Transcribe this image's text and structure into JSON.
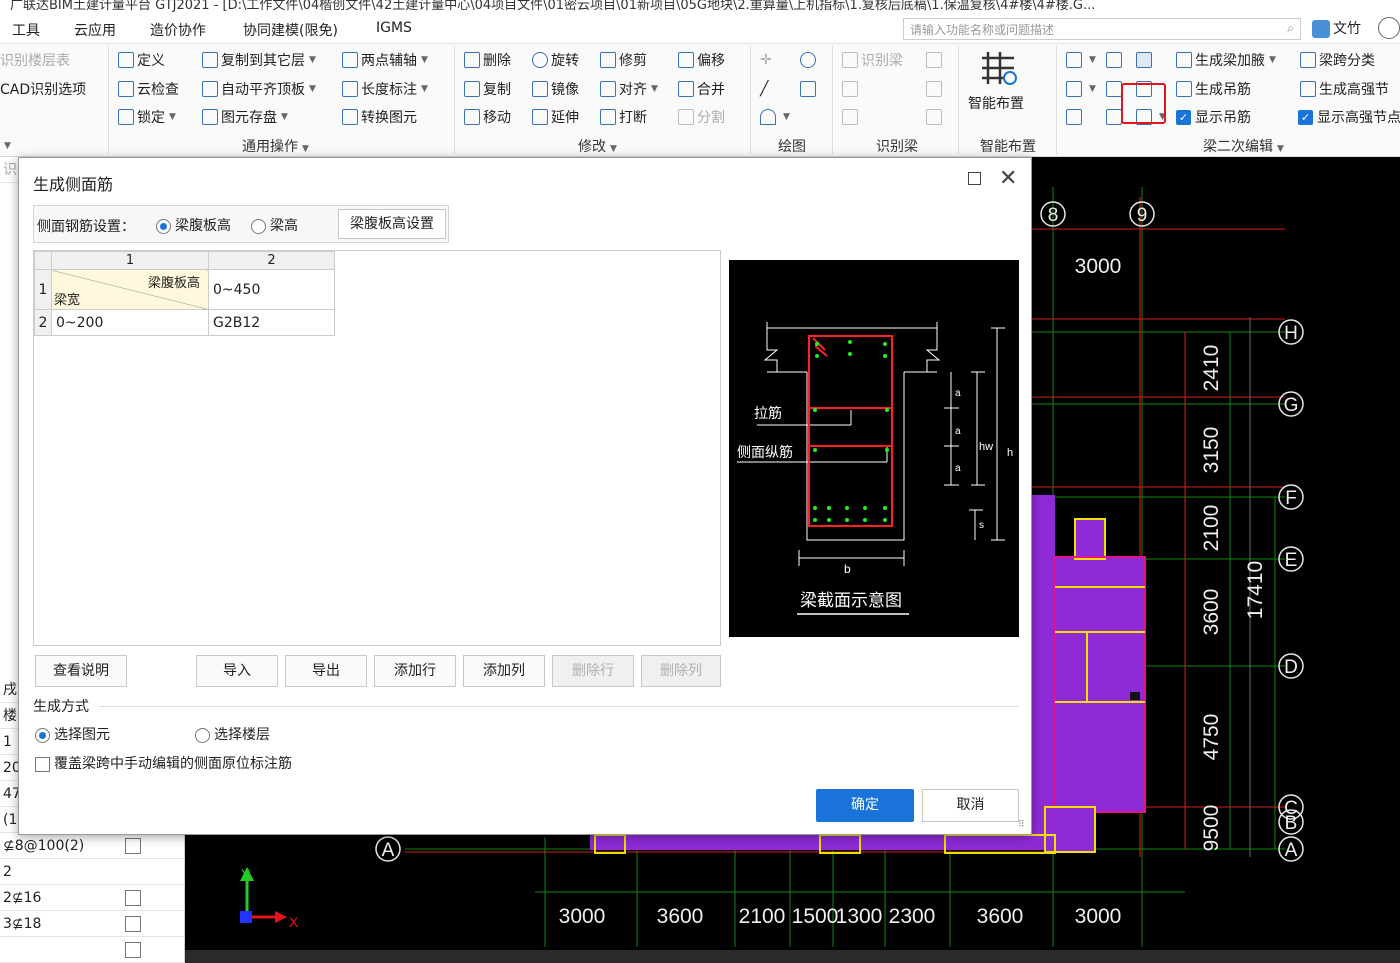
{
  "title_bar": "广联达BIM土建计量平台 GTJ2021 - [D:\\工作文件\\04楷创文件\\42土建计量中心\\04项目文件\\01密云项目\\01新项目\\05G地块\\2.重算量\\上机指标\\1.复核后底稿\\1.保温复核\\4#楼\\4#楼.G...",
  "menu": [
    "工具",
    "云应用",
    "造价协作",
    "协同建模(限免)",
    "IGMS"
  ],
  "search_placeholder": "请输入功能名称或问题描述",
  "doc_label": "文竹",
  "ribbon": {
    "left_items": [
      "识别楼层表",
      "CAD识别选项"
    ],
    "col_a": [
      "定义",
      "云检查",
      "锁定"
    ],
    "col_b": [
      "复制到其它层",
      "自动平齐顶板",
      "图元存盘"
    ],
    "col_c": [
      "两点辅轴",
      "长度标注",
      "转换图元"
    ],
    "group_general": "通用操作",
    "col_d": [
      "删除",
      "复制",
      "移动"
    ],
    "col_e": [
      "旋转",
      "镜像",
      "延伸"
    ],
    "col_f": [
      "修剪",
      "对齐",
      "打断"
    ],
    "col_g": [
      "偏移",
      "合并",
      "分割"
    ],
    "group_modify": "修改",
    "group_draw": "绘图",
    "identify_beam": "识别梁",
    "group_identify": "识别梁",
    "smart_layout": "智能布置",
    "group_smart": "智能布置",
    "col_h": [
      "生成梁加腋",
      "生成吊筋",
      "显示吊筋"
    ],
    "col_i": [
      "梁跨分类",
      "生成高强节",
      "显示高强节点"
    ],
    "group_beam2": "梁二次编辑"
  },
  "left_panel": {
    "rows": [
      "识",
      "",
      "",
      "",
      "",
      "",
      "",
      "",
      "",
      "",
      "",
      "",
      "",
      "",
      "",
      "",
      "",
      "",
      "",
      "戌",
      "楼",
      "1",
      "20",
      "47",
      "(1(",
      "⊈8@100(2)",
      "2",
      "2⊈16",
      "3⊈18",
      ""
    ]
  },
  "canvas": {
    "axis_top": [
      "8",
      "9"
    ],
    "axis_right": [
      "H",
      "G",
      "F",
      "E",
      "D",
      "C",
      "B",
      "A"
    ],
    "axis_left_bottom": "A",
    "dim_top": "3000",
    "dim_right": [
      "2410",
      "3150",
      "2100",
      "3600",
      "4750",
      "9500"
    ],
    "dim_total": "17410",
    "dim_bottom": [
      "3000",
      "3600",
      "2100",
      "1500",
      "1300",
      "2300",
      "3600",
      "3000"
    ],
    "axis_y": "Y",
    "axis_x": "X"
  },
  "dialog": {
    "title": "生成侧面筋",
    "setting_label": "侧面钢筋设置：",
    "radio_web": "梁腹板高",
    "radio_height": "梁高",
    "web_btn": "梁腹板高设置",
    "table": {
      "col_headers": [
        "1",
        "2"
      ],
      "diag_top": "梁腹板高",
      "diag_bottom": "梁宽",
      "row1_val": "0~450",
      "row2_label": "0~200",
      "row2_val": "G2B12"
    },
    "preview": {
      "label_tie": "拉筋",
      "label_side": "侧面纵筋",
      "caption": "梁截面示意图",
      "dim_a": "a",
      "dim_hw": "hw",
      "dim_h": "h",
      "dim_s": "s",
      "dim_b": "b"
    },
    "buttons": [
      "查看说明",
      "导入",
      "导出",
      "添加行",
      "添加列",
      "删除行",
      "删除列"
    ],
    "gen_title": "生成方式",
    "opt_select_elem": "选择图元",
    "opt_select_floor": "选择楼层",
    "cover_label": "覆盖梁跨中手动编辑的侧面原位标注筋",
    "ok": "确定",
    "cancel": "取消"
  }
}
